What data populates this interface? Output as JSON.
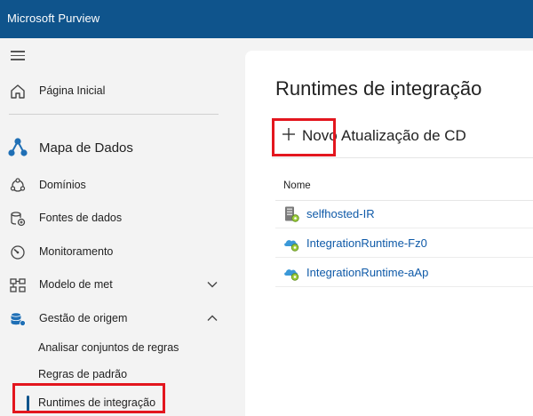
{
  "app": {
    "title": "Microsoft Purview"
  },
  "sidebar": {
    "home": {
      "label": "Página Inicial",
      "icon": "home-icon"
    },
    "section": {
      "label": "Mapa de Dados",
      "icon": "data-map-icon"
    },
    "items": [
      {
        "label": "Domínios",
        "icon": "domains-icon"
      },
      {
        "label": "Fontes de dados",
        "icon": "data-sources-icon"
      },
      {
        "label": "Monitoramento",
        "icon": "monitoring-icon"
      },
      {
        "label": "Modelo de met",
        "icon": "metamodel-icon",
        "expanded": false
      },
      {
        "label": "Gestão de origem",
        "icon": "source-management-icon",
        "expanded": true
      }
    ],
    "sub_items": [
      {
        "label": "Analisar conjuntos de regras"
      },
      {
        "label": "Regras de padrão"
      },
      {
        "label": "Runtimes de integração",
        "selected": true
      }
    ]
  },
  "main": {
    "title": "Runtimes de integração",
    "toolbar": {
      "new_label": "Novo",
      "refresh_label": "Atualização de CD"
    },
    "table": {
      "header": "Nome",
      "rows": [
        {
          "name": "selfhosted-IR",
          "icon": "self-hosted-ir-icon"
        },
        {
          "name": "IntegrationRuntime-Fz0",
          "icon": "azure-ir-icon"
        },
        {
          "name": "IntegrationRuntime-aAp",
          "icon": "azure-ir-icon"
        }
      ]
    }
  },
  "colors": {
    "topbar": "#0f548c",
    "link": "#0f5aa8",
    "highlight": "#e3161e",
    "selected_bar": "#0f548c"
  }
}
